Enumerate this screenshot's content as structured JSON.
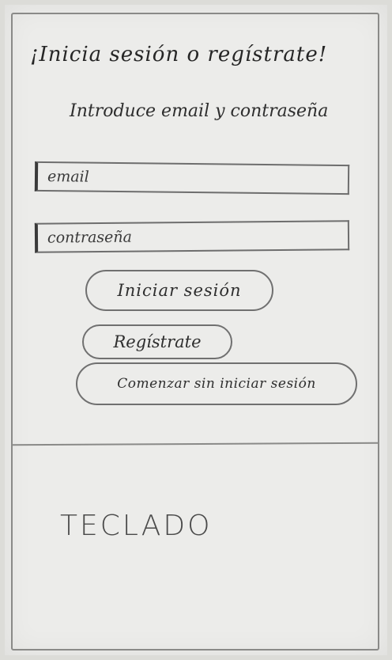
{
  "login_screen": {
    "title": "¡Inicia sesión o regístrate!",
    "subtitle": "Introduce email y contraseña",
    "email_placeholder": "email",
    "password_placeholder": "contraseña",
    "login_button": "Iniciar sesión",
    "register_button": "Regístrate",
    "guest_button": "Comenzar sin iniciar sesión"
  },
  "keyboard": {
    "label": "TECLADO"
  }
}
